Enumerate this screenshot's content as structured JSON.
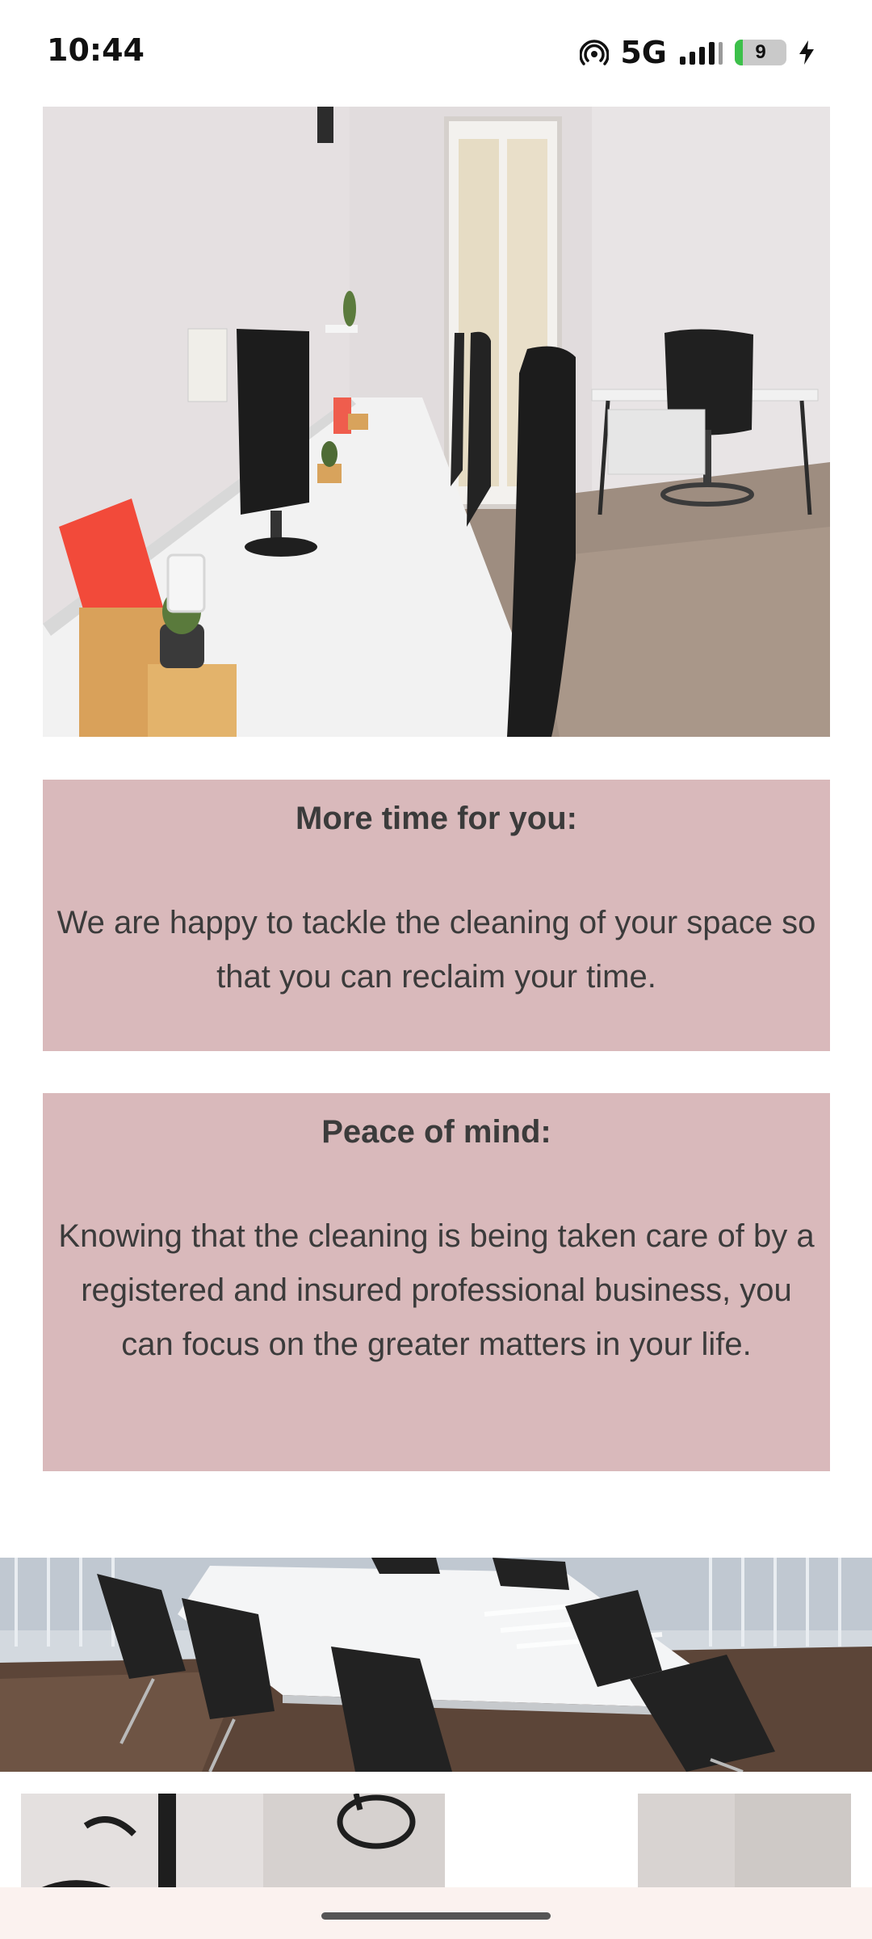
{
  "status_bar": {
    "time": "10:44",
    "network": "5G",
    "battery": "9"
  },
  "cards": [
    {
      "title": "More time for you:",
      "body": "We are happy to tackle the cleaning of your space so that you can reclaim your time."
    },
    {
      "title": "Peace of mind:",
      "body": "Knowing that the cleaning is being taken care of by a registered and insured professional business, you can focus on the greater matters in your life."
    }
  ],
  "colors": {
    "card_background": "#d9b9bb",
    "text": "#3b3b3b",
    "gesture_bar": "#fbf2ef"
  },
  "icons": [
    "hotspot-icon",
    "signal-icon",
    "battery-icon",
    "charging-icon"
  ]
}
